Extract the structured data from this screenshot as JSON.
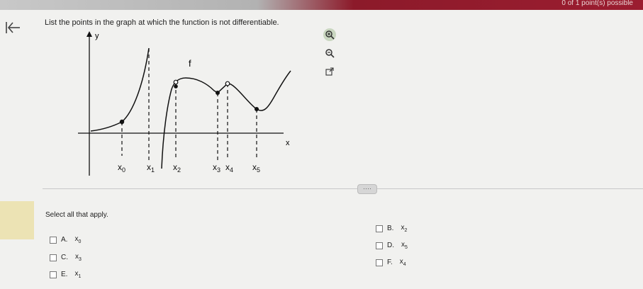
{
  "header": {
    "topbar_text": "0 of 1 point(s) possible"
  },
  "question": {
    "text": "List the points in the graph at which the function is not differentiable."
  },
  "graph": {
    "y_axis_label": "y",
    "x_axis_label": "x",
    "function_label": "f",
    "x_labels": [
      {
        "base": "x",
        "sub": "0"
      },
      {
        "base": "x",
        "sub": "1"
      },
      {
        "base": "x",
        "sub": "2"
      },
      {
        "base": "x",
        "sub": "3"
      },
      {
        "base": "x",
        "sub": "4"
      },
      {
        "base": "x",
        "sub": "5"
      }
    ]
  },
  "tools": [
    "zoom-in-icon",
    "zoom-out-icon",
    "popout-icon"
  ],
  "prompt": "Select all that apply.",
  "options": [
    {
      "letter": "A.",
      "base": "x",
      "sub": "0"
    },
    {
      "letter": "B.",
      "base": "x",
      "sub": "2"
    },
    {
      "letter": "C.",
      "base": "x",
      "sub": "3"
    },
    {
      "letter": "D.",
      "base": "x",
      "sub": "5"
    },
    {
      "letter": "E.",
      "base": "x",
      "sub": "1"
    },
    {
      "letter": "F.",
      "base": "x",
      "sub": "4"
    }
  ],
  "handle_text": "····"
}
